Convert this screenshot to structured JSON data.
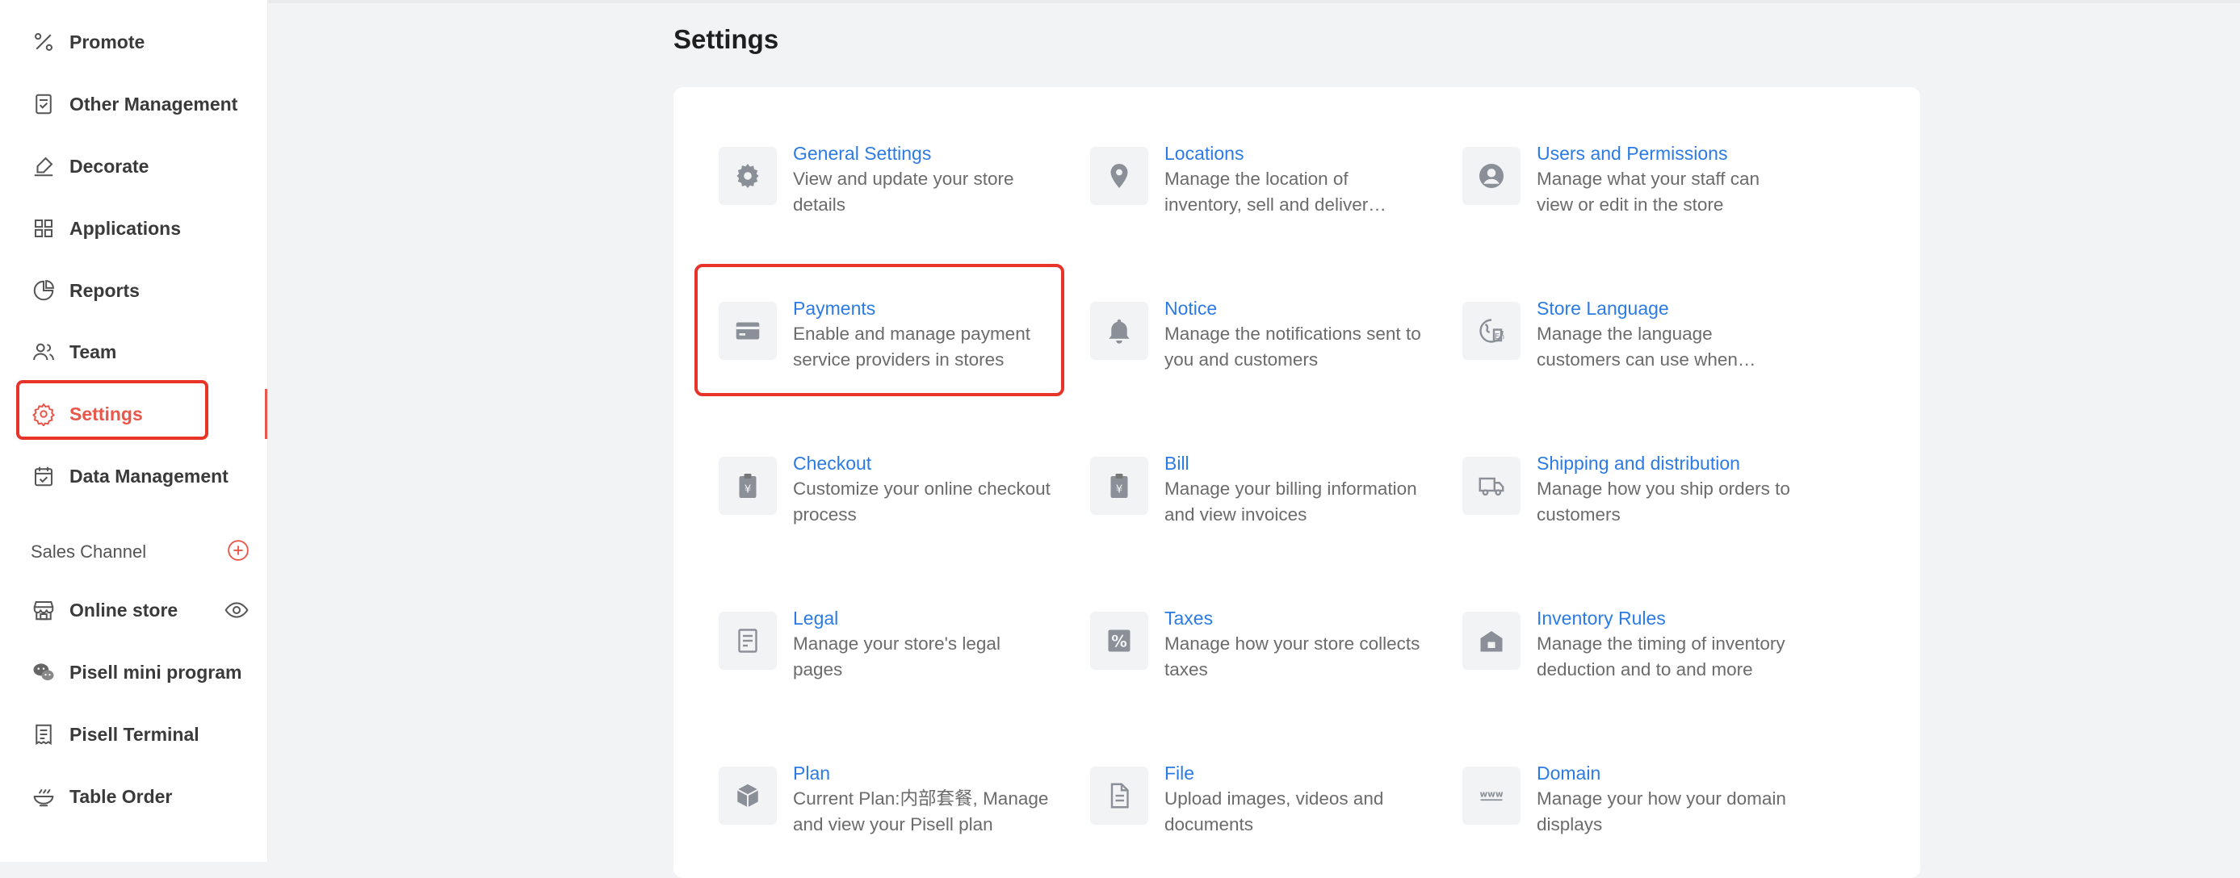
{
  "sidebar": {
    "items": [
      {
        "label": "Promote",
        "icon": "percent-icon"
      },
      {
        "label": "Other Management",
        "icon": "clipboard-icon"
      },
      {
        "label": "Decorate",
        "icon": "brush-icon"
      },
      {
        "label": "Applications",
        "icon": "grid-icon"
      },
      {
        "label": "Reports",
        "icon": "pie-chart-icon"
      },
      {
        "label": "Team",
        "icon": "team-icon"
      },
      {
        "label": "Settings",
        "icon": "gear-icon"
      },
      {
        "label": "Data Management",
        "icon": "calendar-check-icon"
      }
    ],
    "section_title": "Sales Channel",
    "channels": [
      {
        "label": "Online store",
        "icon": "store-icon"
      },
      {
        "label": "Pisell mini program",
        "icon": "wechat-icon"
      },
      {
        "label": "Pisell Terminal",
        "icon": "receipt-icon"
      },
      {
        "label": "Table Order",
        "icon": "bowl-icon"
      }
    ]
  },
  "main": {
    "title": "Settings",
    "cards": [
      {
        "title": "General Settings",
        "desc": "View and update your store details",
        "icon": "gear-icon"
      },
      {
        "title": "Locations",
        "desc": "Manage the location of inventory, sell and deliver orders",
        "icon": "location-pin-icon"
      },
      {
        "title": "Users and Permissions",
        "desc": "Manage what your staff can view or edit in the store",
        "icon": "user-circle-icon"
      },
      {
        "title": "Payments",
        "desc": "Enable and manage payment service providers in stores",
        "icon": "credit-card-icon"
      },
      {
        "title": "Notice",
        "desc": "Manage the notifications sent to you and customers",
        "icon": "bell-icon"
      },
      {
        "title": "Store Language",
        "desc": "Manage the language customers can use when visiting",
        "icon": "language-icon"
      },
      {
        "title": "Checkout",
        "desc": "Customize your online checkout process",
        "icon": "yen-clipboard-icon"
      },
      {
        "title": "Bill",
        "desc": "Manage your billing information and view invoices",
        "icon": "yen-clipboard-icon"
      },
      {
        "title": "Shipping and distribution",
        "desc": "Manage how you ship orders to customers",
        "icon": "truck-icon"
      },
      {
        "title": "Legal",
        "desc": "Manage your store's legal pages",
        "icon": "document-icon"
      },
      {
        "title": "Taxes",
        "desc": "Manage how your store collects taxes",
        "icon": "percent-box-icon"
      },
      {
        "title": "Inventory Rules",
        "desc": "Manage the timing of inventory deduction and to and more",
        "icon": "warehouse-icon"
      },
      {
        "title": "Plan",
        "desc": "Current Plan:内部套餐, Manage and view your Pisell plan",
        "icon": "cube-icon"
      },
      {
        "title": "File",
        "desc": "Upload images, videos and documents",
        "icon": "file-icon"
      },
      {
        "title": "Domain",
        "desc": "Manage your how your domain displays",
        "icon": "www-icon"
      }
    ]
  },
  "colors": {
    "accent": "#e8574a",
    "highlight": "#e8332b",
    "link": "#2c7be5",
    "icon": "#8a8f98"
  }
}
